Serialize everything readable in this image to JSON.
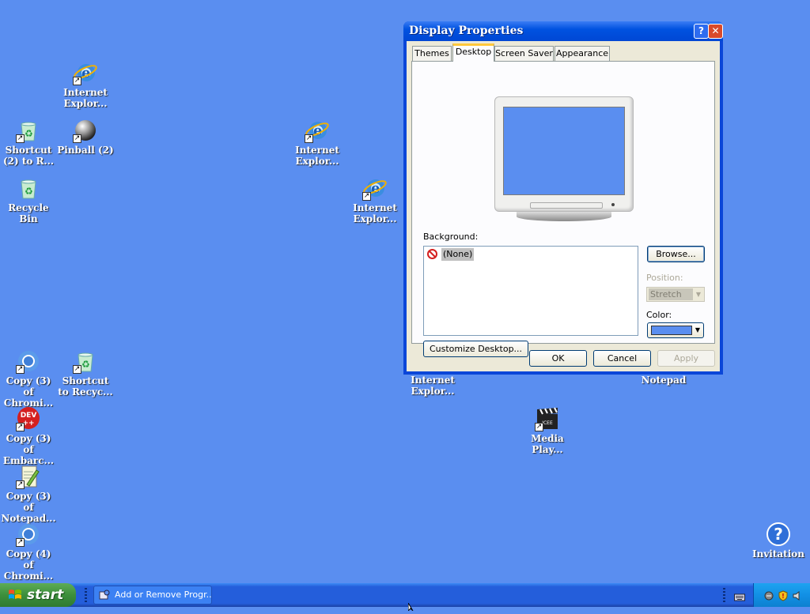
{
  "desktop": {
    "background_color": "#5a8ef0",
    "icons": [
      {
        "label": "Internet Explor...",
        "icon": "internet-explorer-icon"
      },
      {
        "label": "Shortcut (2) to R...",
        "icon": "recycle-bin-icon"
      },
      {
        "label": "Pinball (2)",
        "icon": "pinball-icon"
      },
      {
        "label": "Recycle Bin",
        "icon": "recycle-bin-icon"
      },
      {
        "label": "Internet Explor...",
        "icon": "internet-explorer-icon"
      },
      {
        "label": "Internet Explor...",
        "icon": "internet-explorer-icon"
      },
      {
        "label": "Copy (3) of Chromi...",
        "icon": "chromium-icon"
      },
      {
        "label": "Shortcut to Recyc...",
        "icon": "recycle-bin-icon"
      },
      {
        "label": "Copy (3) of Embarc...",
        "icon": "dev-cpp-icon",
        "badge": "DEV ++"
      },
      {
        "label": "Copy (3) of Notepad...",
        "icon": "notepad-plus-icon"
      },
      {
        "label": "Copy (4) of Chromi...",
        "icon": "chromium-icon"
      },
      {
        "label": "Internet Explor...",
        "icon": "internet-explorer-icon"
      },
      {
        "label": "Notepad",
        "icon": "notepad-icon"
      },
      {
        "label": "Media Play...",
        "icon": "media-player-icon"
      },
      {
        "label": "Invitation",
        "icon": "help-question-icon"
      }
    ]
  },
  "dialog": {
    "title": "Display Properties",
    "help_button": "?",
    "close_button": "✕",
    "tabs": [
      {
        "label": "Themes",
        "active": false
      },
      {
        "label": "Desktop",
        "active": true
      },
      {
        "label": "Screen Saver",
        "active": false
      },
      {
        "label": "Appearance",
        "active": false
      }
    ],
    "background_label": "Background:",
    "background_items": [
      {
        "label": "(None)",
        "selected": true
      }
    ],
    "browse_button": "Browse...",
    "position_label": "Position:",
    "position_value": "Stretch",
    "color_label": "Color:",
    "color_value": "#5a8ef0",
    "customize_button": "Customize Desktop...",
    "ok_button": "OK",
    "cancel_button": "Cancel",
    "apply_button": "Apply"
  },
  "taskbar": {
    "start_label": "start",
    "task_buttons": [
      {
        "label": "Add or Remove Progr...",
        "icon": "add-remove-programs-icon"
      }
    ],
    "tray_icons": [
      "keyboard-icon",
      "network-icon",
      "security-shield-icon",
      "volume-icon"
    ]
  }
}
